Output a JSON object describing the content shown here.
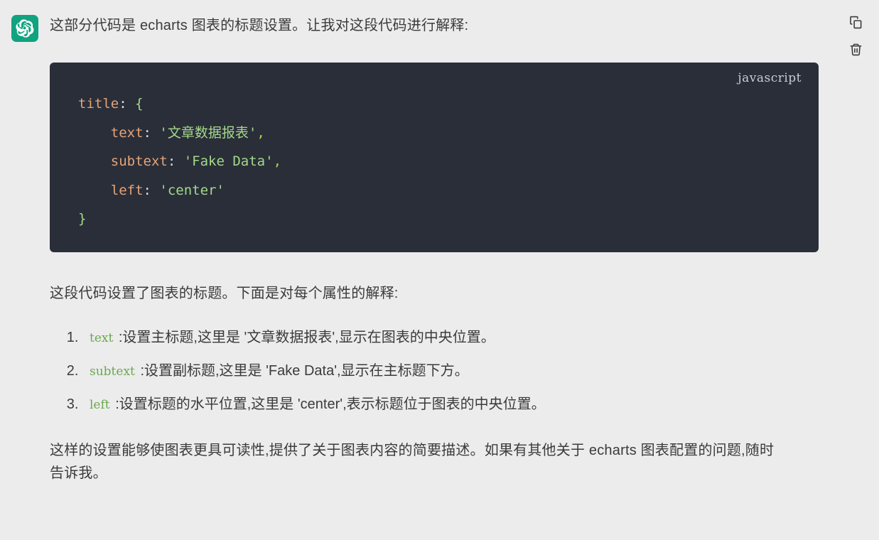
{
  "message": {
    "role": "assistant",
    "avatar_icon": "openai-logo-icon",
    "avatar_color": "#10a37f",
    "intro_text": "这部分代码是 echarts 图表的标题设置。让我对这段代码进行解释:",
    "explain_text": "这段代码设置了图表的标题。下面是对每个属性的解释:",
    "closing_text": "这样的设置能够使图表更具可读性,提供了关于图表内容的简要描述。如果有其他关于 echarts 图表配置的问题,随时告诉我。"
  },
  "code_block": {
    "language_label": "javascript",
    "background": "#2a2e39",
    "lines": [
      {
        "indent": 0,
        "tokens": [
          {
            "text": "title",
            "type": "key"
          },
          {
            "text": ": ",
            "type": "plain"
          },
          {
            "text": "{",
            "type": "brace"
          }
        ]
      },
      {
        "indent": 1,
        "tokens": [
          {
            "text": "text",
            "type": "key"
          },
          {
            "text": ": ",
            "type": "plain"
          },
          {
            "text": "'文章数据报表'",
            "type": "str"
          },
          {
            "text": ",",
            "type": "punct"
          }
        ]
      },
      {
        "indent": 1,
        "tokens": [
          {
            "text": "subtext",
            "type": "key"
          },
          {
            "text": ": ",
            "type": "plain"
          },
          {
            "text": "'Fake Data'",
            "type": "str"
          },
          {
            "text": ",",
            "type": "punct"
          }
        ]
      },
      {
        "indent": 1,
        "tokens": [
          {
            "text": "left",
            "type": "key"
          },
          {
            "text": ": ",
            "type": "plain"
          },
          {
            "text": "'center'",
            "type": "str"
          }
        ]
      },
      {
        "indent": 0,
        "tokens": [
          {
            "text": "}",
            "type": "brace"
          }
        ]
      }
    ],
    "plain_text": "title: {\n    text: '文章数据报表',\n    subtext: 'Fake Data',\n    left: 'center'\n}"
  },
  "points": [
    {
      "number": "1.",
      "code": "text",
      "description": ":设置主标题,这里是 '文章数据报表',显示在图表的中央位置。"
    },
    {
      "number": "2.",
      "code": "subtext",
      "description": ":设置副标题,这里是 'Fake Data',显示在主标题下方。"
    },
    {
      "number": "3.",
      "code": "left",
      "description": ":设置标题的水平位置,这里是 'center',表示标题位于图表的中央位置。"
    }
  ],
  "actions": [
    {
      "name": "copy-icon",
      "label": "Copy"
    },
    {
      "name": "delete-icon",
      "label": "Delete"
    }
  ],
  "theme": {
    "page_background": "#ececec",
    "text_color": "#3b3b3b",
    "code_key_color": "#e2a478",
    "code_string_color": "#a3d98a",
    "inline_code_color": "#6aa84f",
    "accent_color": "#10a37f"
  }
}
